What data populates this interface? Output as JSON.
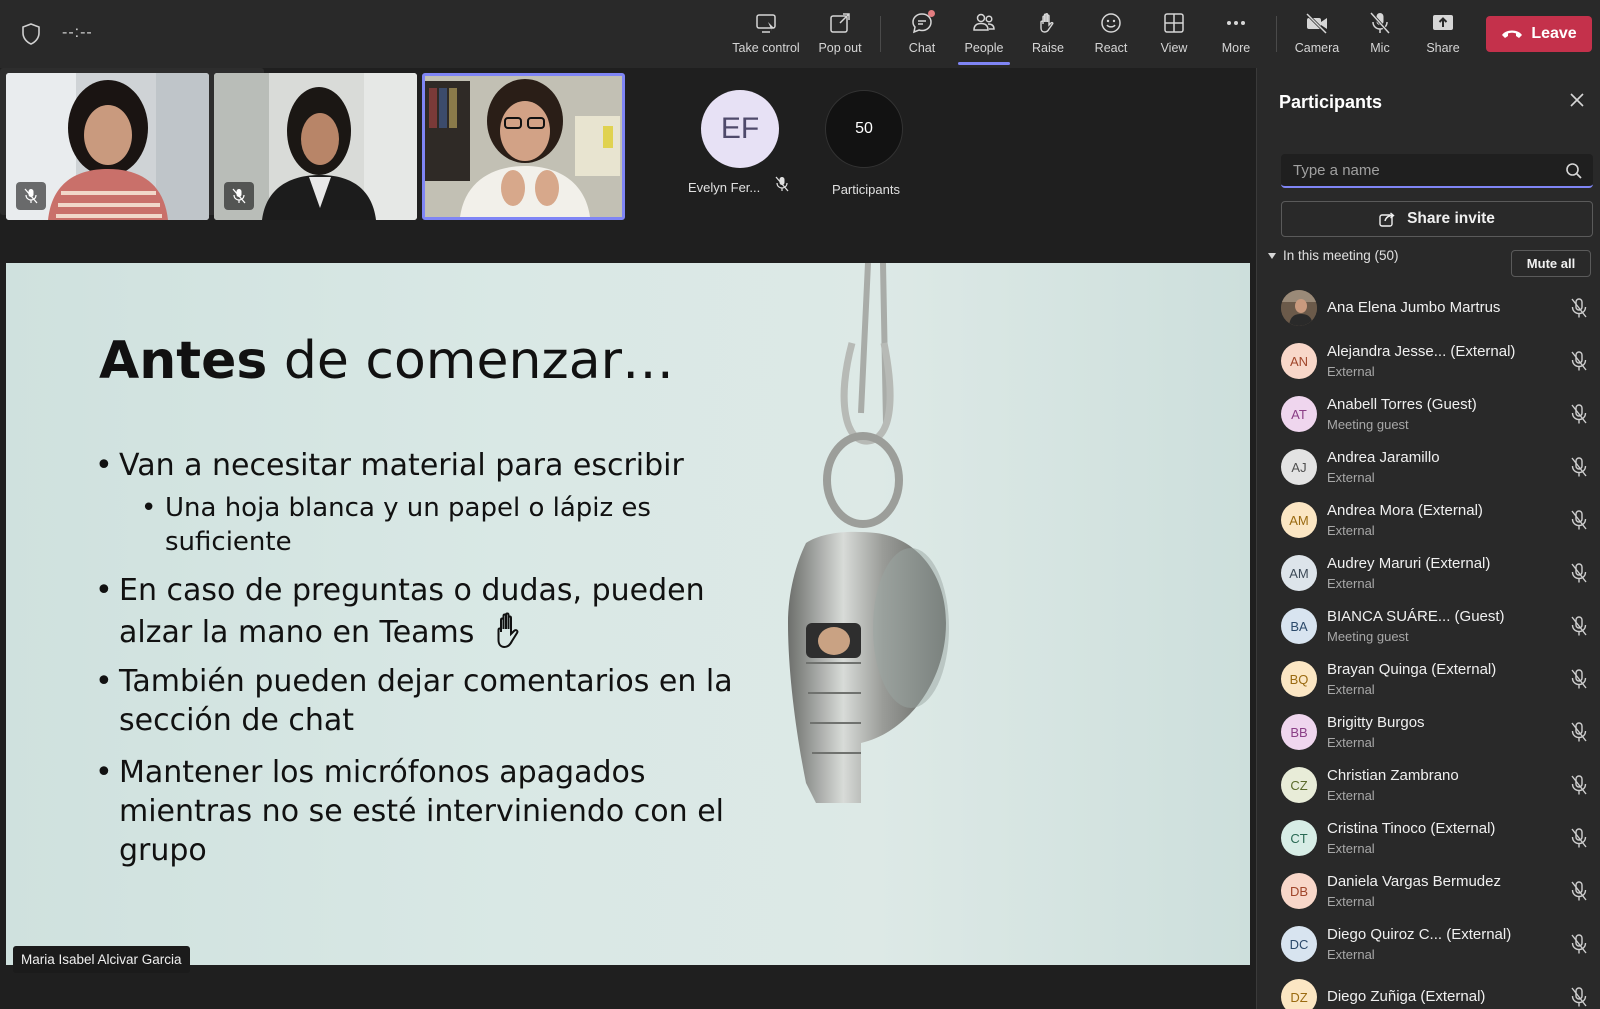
{
  "toolbar": {
    "timer": "--:--",
    "take_control": "Take control",
    "pop_out": "Pop out",
    "chat": "Chat",
    "people": "People",
    "raise": "Raise",
    "react": "React",
    "view": "View",
    "more": "More",
    "camera": "Camera",
    "mic": "Mic",
    "share": "Share",
    "leave": "Leave"
  },
  "stage": {
    "ef_initials": "EF",
    "ef_name": "Evelyn Fer...",
    "participant_count": "50",
    "participants_label": "Participants",
    "presenter_name": "Maria Isabel Alcivar Garcia"
  },
  "slide": {
    "title_bold": "Antes",
    "title_rest": " de comenzar…",
    "bullet1": "Van a necesitar material para escribir",
    "sub1_line1": "Una hoja blanca y un papel o lápiz es",
    "sub1_line2": "suficiente",
    "bullet2_line1": "En caso de preguntas o dudas, pueden",
    "bullet2_line2": "alzar la mano en Teams",
    "bullet3_line1": "También pueden dejar comentarios en la",
    "bullet3_line2": "sección de chat",
    "bullet4_line1": "Mantener los micrófonos apagados",
    "bullet4_line2": "mientras no se esté interviniendo con el",
    "bullet4_line3": "grupo"
  },
  "panel": {
    "title": "Participants",
    "search_placeholder": "Type a name",
    "share_invite": "Share invite",
    "in_meeting": "In this meeting (50)",
    "mute_all": "Mute all",
    "participants": [
      {
        "initials": "",
        "name": "Ana Elena Jumbo Martrus",
        "role": "",
        "bg": "#6b5a4a",
        "fg": "#fff"
      },
      {
        "initials": "AN",
        "name": "Alejandra Jesse...  (External)",
        "role": "External",
        "bg": "#f8d7c9",
        "fg": "#a0452a"
      },
      {
        "initials": "AT",
        "name": "Anabell Torres (Guest)",
        "role": "Meeting guest",
        "bg": "#efd6ee",
        "fg": "#8a3e86"
      },
      {
        "initials": "AJ",
        "name": "Andrea Jaramillo",
        "role": "External",
        "bg": "#e3e3e3",
        "fg": "#505050"
      },
      {
        "initials": "AM",
        "name": "Andrea Mora (External)",
        "role": "External",
        "bg": "#fbe6c3",
        "fg": "#9a6a10"
      },
      {
        "initials": "AM",
        "name": "Audrey Maruri (External)",
        "role": "External",
        "bg": "#dde4ea",
        "fg": "#3d4a57"
      },
      {
        "initials": "BA",
        "name": "BIANCA SUÁRE...  (Guest)",
        "role": "Meeting guest",
        "bg": "#d8e4f0",
        "fg": "#2c4a6b"
      },
      {
        "initials": "BQ",
        "name": "Brayan Quinga (External)",
        "role": "External",
        "bg": "#fbe6c3",
        "fg": "#9a6a10"
      },
      {
        "initials": "BB",
        "name": "Brigitty Burgos",
        "role": "External",
        "bg": "#efd6ee",
        "fg": "#8a3e86"
      },
      {
        "initials": "CZ",
        "name": "Christian Zambrano",
        "role": "External",
        "bg": "#e8ecd8",
        "fg": "#5a6a2a"
      },
      {
        "initials": "CT",
        "name": "Cristina Tinoco (External)",
        "role": "External",
        "bg": "#d7ede6",
        "fg": "#2a6a54"
      },
      {
        "initials": "DB",
        "name": "Daniela Vargas Bermudez",
        "role": "External",
        "bg": "#f8d7c9",
        "fg": "#a0452a"
      },
      {
        "initials": "DC",
        "name": "Diego Quiroz C...  (External)",
        "role": "External",
        "bg": "#d8e4f0",
        "fg": "#2c4a6b"
      },
      {
        "initials": "DZ",
        "name": "Diego Zuñiga (External)",
        "role": "",
        "bg": "#fbe6c3",
        "fg": "#9a6a10"
      }
    ]
  }
}
